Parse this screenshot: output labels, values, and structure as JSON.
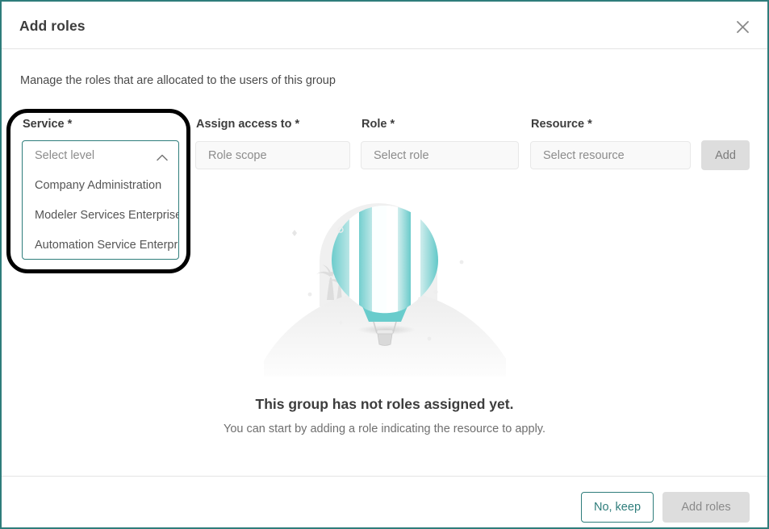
{
  "dialog": {
    "title": "Add roles",
    "subtitle": "Manage the roles that are allocated to the users of this group",
    "close_icon": "close-icon"
  },
  "form": {
    "service": {
      "label": "Service *",
      "placeholder": "Select level",
      "expanded": true,
      "chevron_icon": "chevron-up-icon",
      "options": [
        "Company Administration",
        "Modeler Services Enterprise",
        "Automation Service Enterprise"
      ]
    },
    "assign_access_to": {
      "label": "Assign access to *",
      "placeholder": "Role scope",
      "value": ""
    },
    "role": {
      "label": "Role *",
      "placeholder": "Select role",
      "value": ""
    },
    "resource": {
      "label": "Resource *",
      "placeholder": "Select resource",
      "value": ""
    },
    "add_button": "Add"
  },
  "empty_state": {
    "illustration": "hot-air-balloon-illustration",
    "title": "This group has not roles assigned yet.",
    "subtitle": "You can start by adding a role indicating the resource to apply."
  },
  "footer": {
    "keep_label": "No, keep",
    "add_roles_label": "Add roles"
  },
  "colors": {
    "accent": "#2e7d7b",
    "balloon_teal": "#7fd4d4",
    "disabled_bg": "#dddddd",
    "annotation": "#000000",
    "text_primary": "#3d3d3d",
    "text_muted": "#8c8c8c"
  }
}
